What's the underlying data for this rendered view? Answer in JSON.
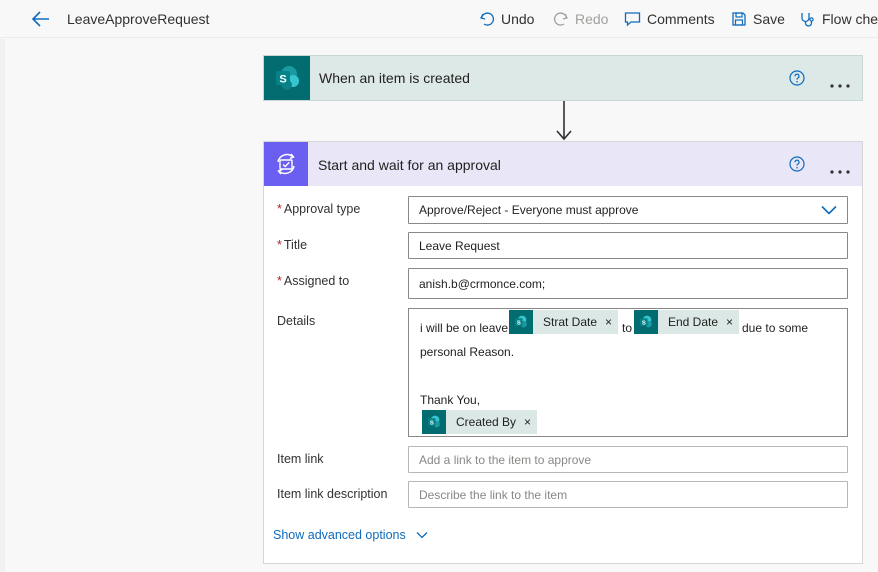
{
  "header": {
    "flow_name": "LeaveApproveRequest",
    "undo_label": "Undo",
    "redo_label": "Redo",
    "comments_label": "Comments",
    "save_label": "Save",
    "flow_checker_label": "Flow che"
  },
  "trigger": {
    "title": "When an item is created",
    "icon": "sharepoint-icon"
  },
  "approval": {
    "title": "Start and wait for an approval",
    "icon": "approval-icon",
    "fields": {
      "approval_type": {
        "label": "Approval type",
        "required": "*",
        "value": "Approve/Reject - Everyone must approve"
      },
      "title": {
        "label": "Title",
        "required": "*",
        "value": "Leave Request"
      },
      "assigned_to": {
        "label": "Assigned to",
        "required": "*",
        "value": "anish.b@crmonce.com;"
      },
      "details": {
        "label": "Details",
        "text_1": "i will be on leave",
        "token_1": "Strat Date",
        "text_2": "to",
        "token_2": "End Date",
        "text_3": "due to some",
        "text_4": "personal Reason.",
        "text_5": "Thank You,",
        "token_3": "Created By",
        "token_remove": "×"
      },
      "item_link": {
        "label": "Item link",
        "placeholder": "Add a link to the item to approve"
      },
      "item_link_description": {
        "label": "Item link description",
        "placeholder": "Describe the link to the item"
      }
    },
    "advanced_label": "Show advanced options"
  },
  "colors": {
    "accent": "#0f6cbd",
    "sharepoint": "#036c70",
    "approval": "#6b5ff1",
    "trigger_bg": "#dde9e7",
    "approval_header_bg": "#e9e6f7",
    "required": "#a4262c"
  }
}
